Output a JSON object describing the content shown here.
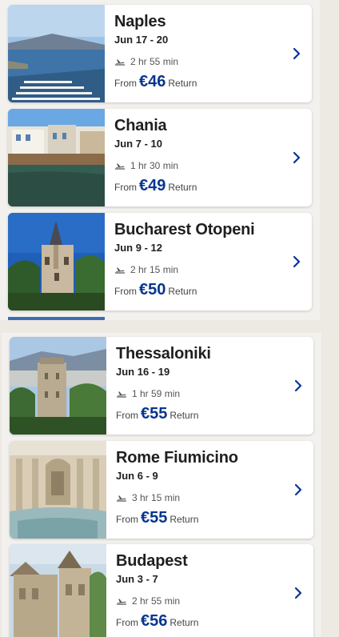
{
  "colors": {
    "price": "#073590",
    "chevron": "#073590",
    "background": "#ede9e3"
  },
  "panel_top": {
    "cards": [
      {
        "city": "Naples",
        "dates": "Jun 17 - 20",
        "duration": "2 hr 55 min",
        "from_label": "From",
        "price": "€46",
        "return_label": "Return",
        "image": "naples-harbor-photo"
      },
      {
        "city": "Chania",
        "dates": "Jun 7 - 10",
        "duration": "1 hr 30 min",
        "from_label": "From",
        "price": "€49",
        "return_label": "Return",
        "image": "chania-waterfront-photo"
      },
      {
        "city": "Bucharest Otopeni",
        "dates": "Jun 9 - 12",
        "duration": "2 hr 15 min",
        "from_label": "From",
        "price": "€50",
        "return_label": "Return",
        "image": "peles-castle-photo"
      }
    ]
  },
  "panel_bottom": {
    "cards": [
      {
        "city": "Thessaloniki",
        "dates": "Jun 16 - 19",
        "duration": "1 hr 59 min",
        "from_label": "From",
        "price": "€55",
        "return_label": "Return",
        "image": "white-tower-photo"
      },
      {
        "city": "Rome Fiumicino",
        "dates": "Jun 6 - 9",
        "duration": "3 hr 15 min",
        "from_label": "From",
        "price": "€55",
        "return_label": "Return",
        "image": "trevi-fountain-photo"
      },
      {
        "city": "Budapest",
        "dates": "Jun 3 - 7",
        "duration": "2 hr 55 min",
        "from_label": "From",
        "price": "€56",
        "return_label": "Return",
        "image": "fishermans-bastion-photo"
      }
    ]
  }
}
